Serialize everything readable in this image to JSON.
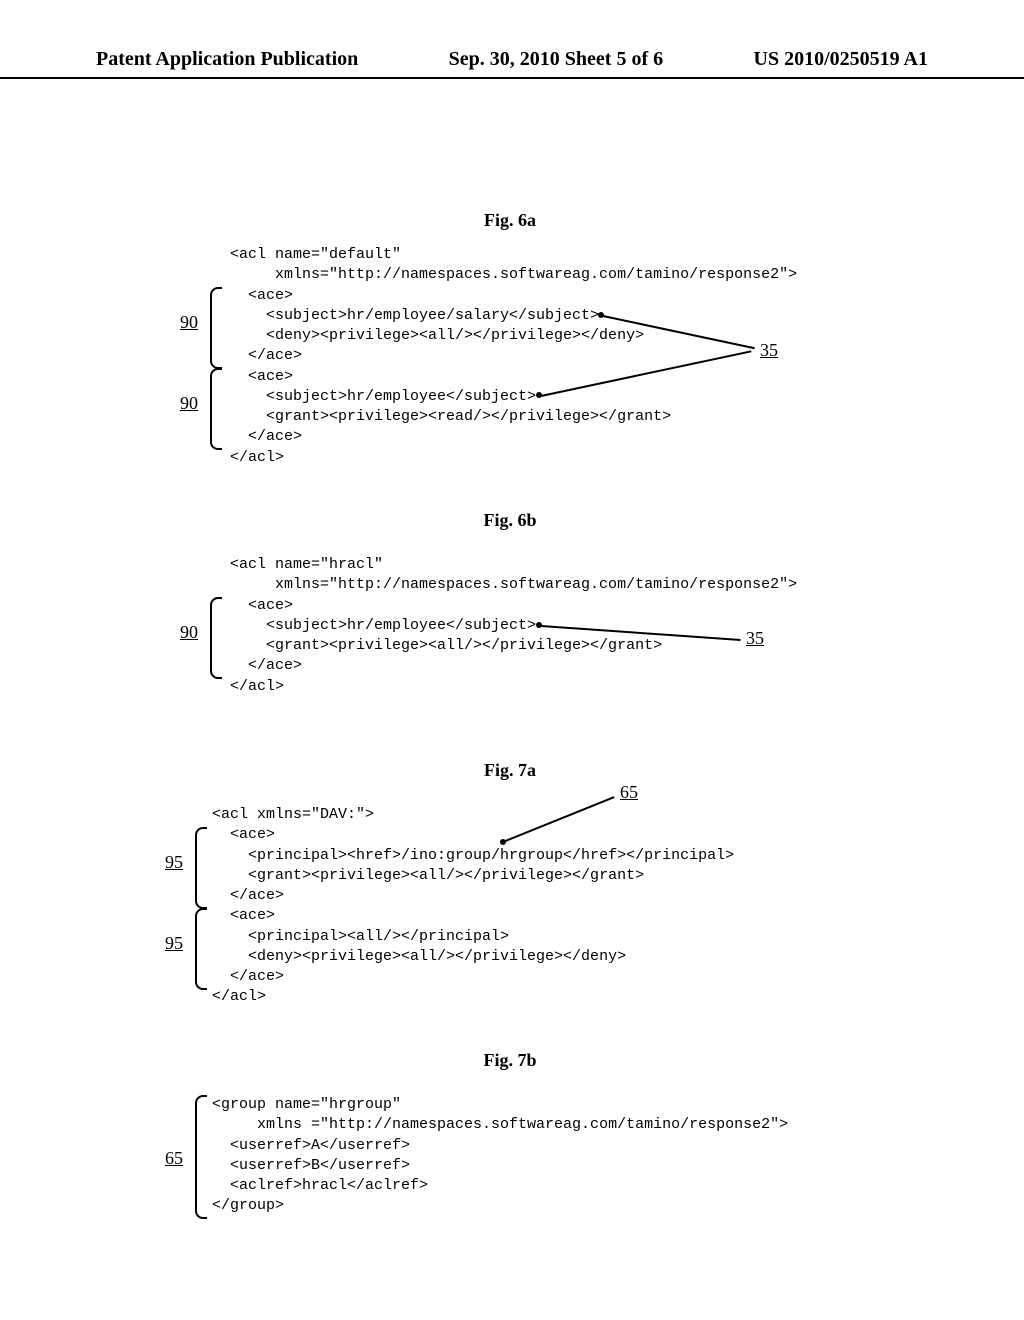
{
  "header": {
    "left": "Patent Application Publication",
    "center": "Sep. 30, 2010  Sheet 5 of 6",
    "right": "US 2010/0250519 A1"
  },
  "figures": {
    "f6a": {
      "label": "Fig. 6a",
      "code": "<acl name=\"default\"\n     xmlns=\"http://namespaces.softwareag.com/tamino/response2\">\n  <ace>\n    <subject>hr/employee/salary</subject>\n    <deny><privilege><all/></privilege></deny>\n  </ace>\n  <ace>\n    <subject>hr/employee</subject>\n    <grant><privilege><read/></privilege></grant>\n  </ace>\n</acl>",
      "ref90a": "90",
      "ref90b": "90",
      "ref35": "35"
    },
    "f6b": {
      "label": "Fig. 6b",
      "code": "<acl name=\"hracl\"\n     xmlns=\"http://namespaces.softwareag.com/tamino/response2\">\n  <ace>\n    <subject>hr/employee</subject>\n    <grant><privilege><all/></privilege></grant>\n  </ace>\n</acl>",
      "ref90": "90",
      "ref35": "35"
    },
    "f7a": {
      "label": "Fig. 7a",
      "code": "<acl xmlns=\"DAV:\">\n  <ace>\n    <principal><href>/ino:group/hrgroup</href></principal>\n    <grant><privilege><all/></privilege></grant>\n  </ace>\n  <ace>\n    <principal><all/></principal>\n    <deny><privilege><all/></privilege></deny>\n  </ace>\n</acl>",
      "ref95a": "95",
      "ref95b": "95",
      "ref65": "65"
    },
    "f7b": {
      "label": "Fig. 7b",
      "code": "<group name=\"hrgroup\"\n     xmlns =\"http://namespaces.softwareag.com/tamino/response2\">\n  <userref>A</userref>\n  <userref>B</userref>\n  <aclref>hracl</aclref>\n</group>",
      "ref65": "65"
    }
  }
}
